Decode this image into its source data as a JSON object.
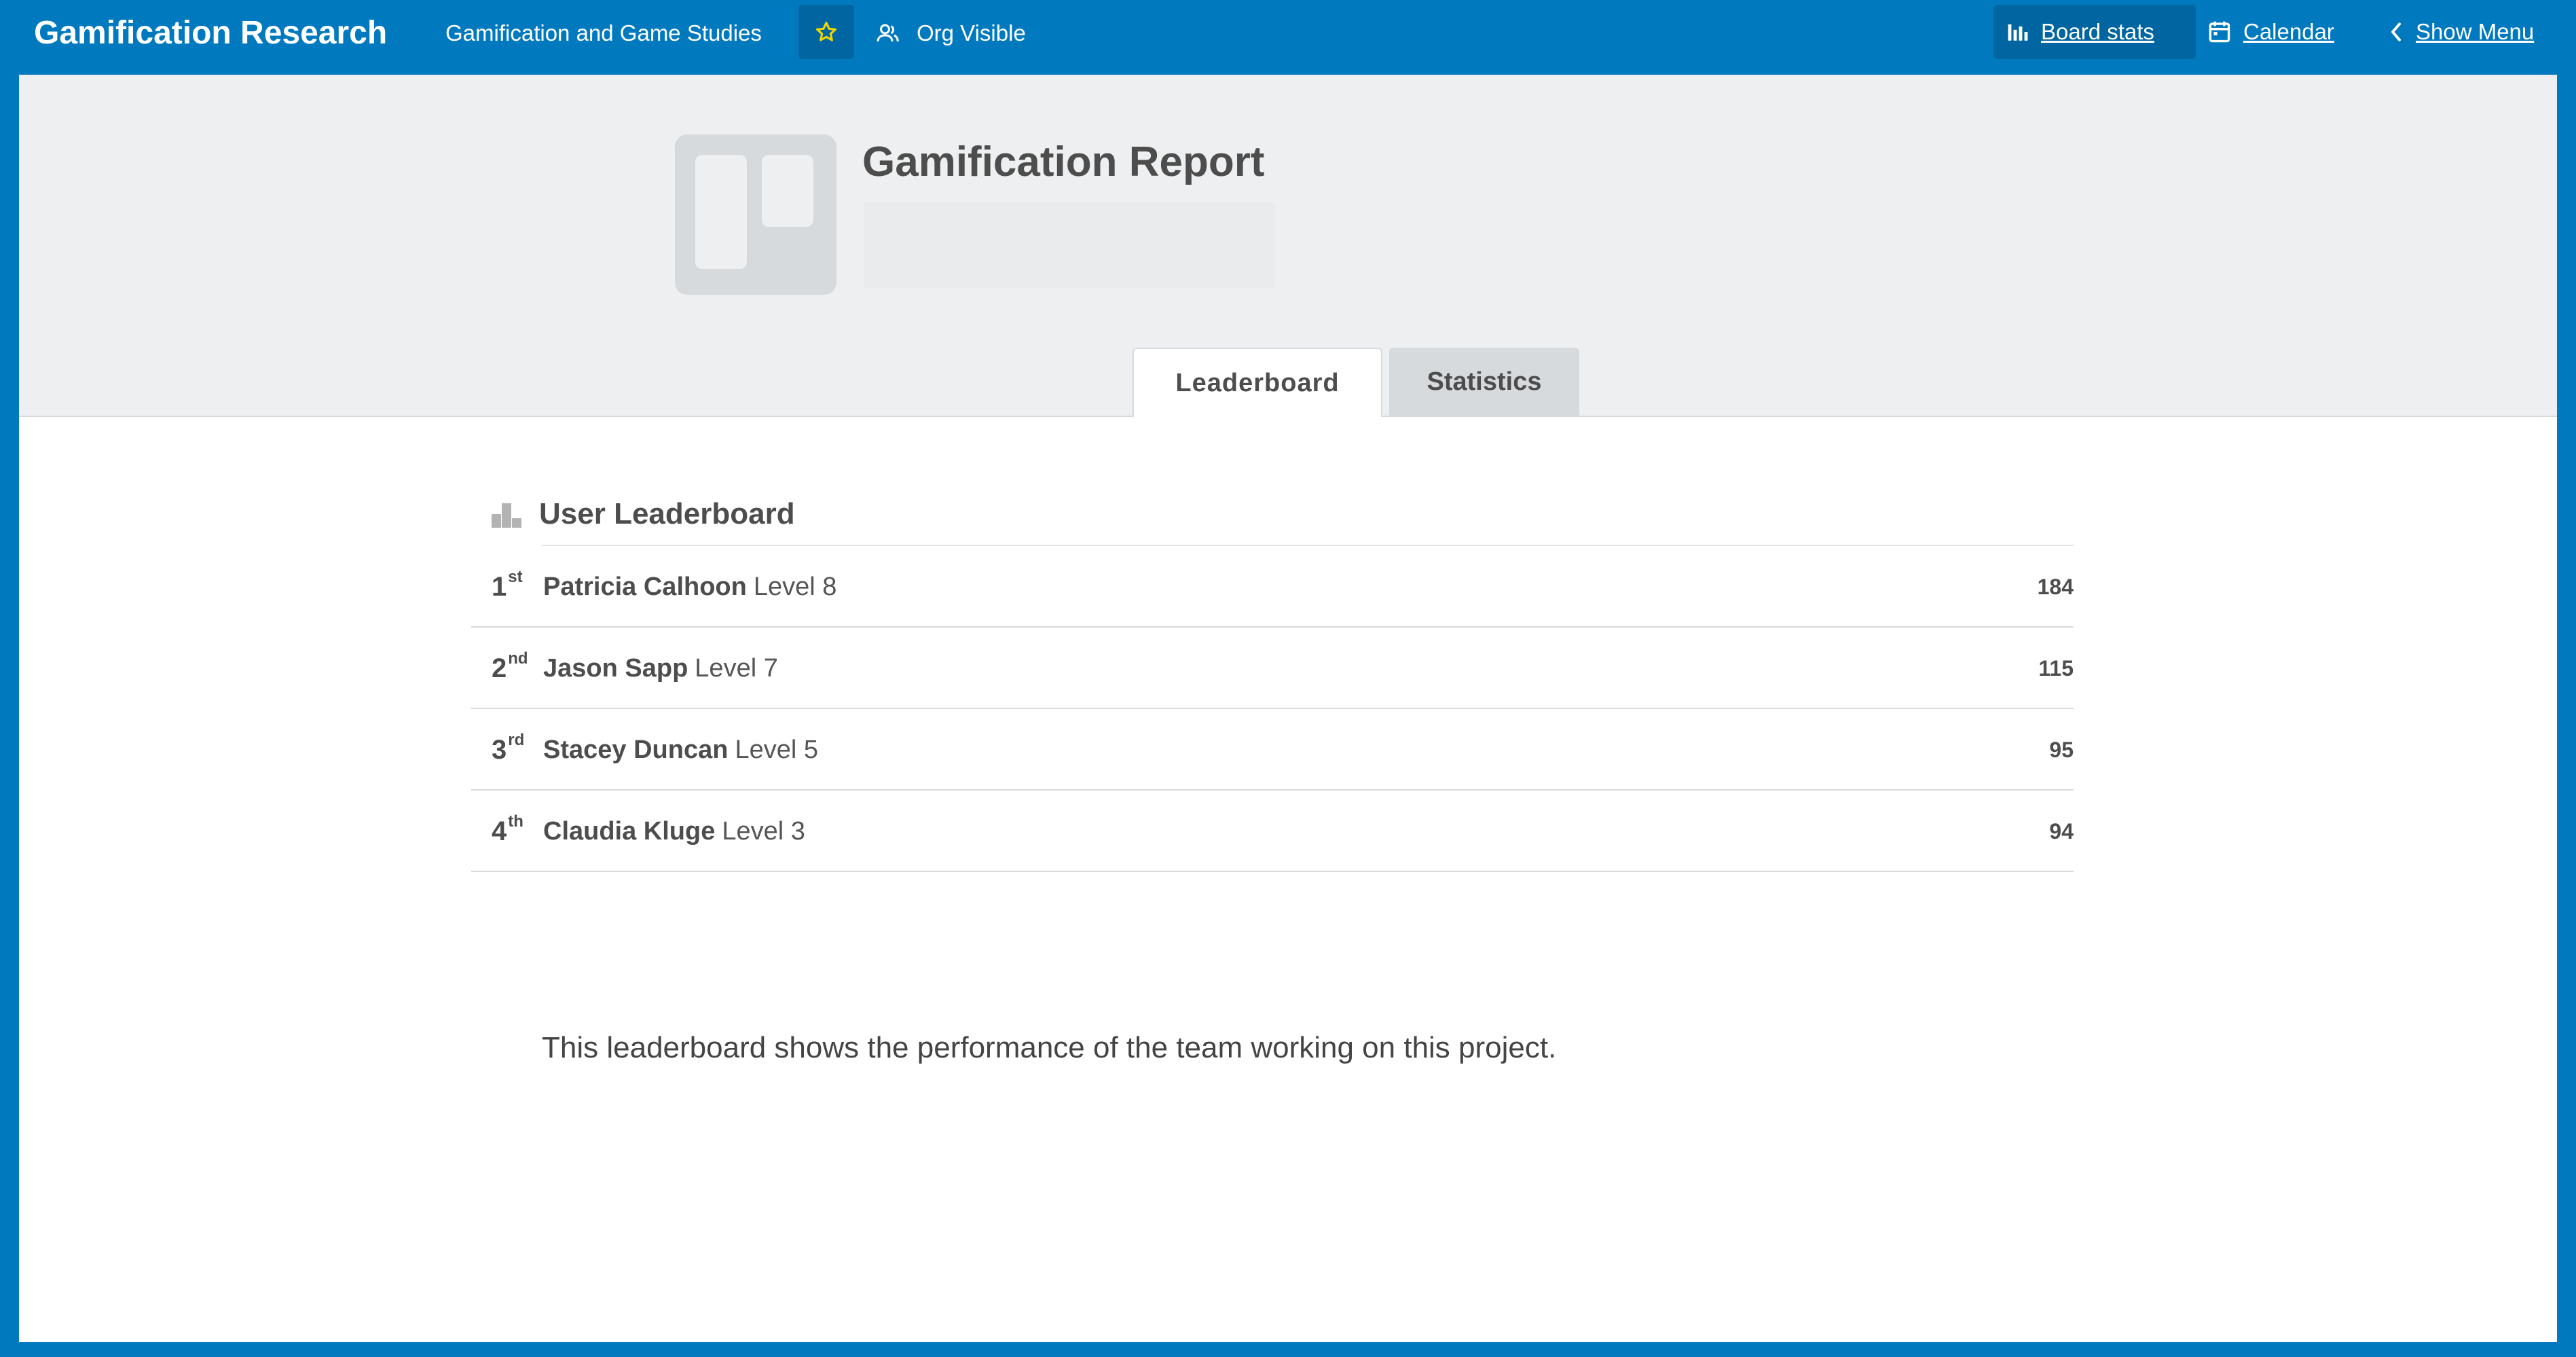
{
  "topbar": {
    "board_title": "Gamification Research",
    "team_name": "Gamification and Game Studies",
    "visibility_label": "Org Visible",
    "board_stats_label": "Board stats",
    "calendar_label": "Calendar",
    "show_menu_label": "Show Menu"
  },
  "report": {
    "title": "Gamification Report"
  },
  "tabs": [
    {
      "label": "Leaderboard",
      "active": true
    },
    {
      "label": "Statistics",
      "active": false
    }
  ],
  "leaderboard": {
    "title": "User Leaderboard",
    "rows": [
      {
        "rank": "1",
        "suffix": "st",
        "name": "Patricia Calhoon",
        "level": "Level 8",
        "score": "184"
      },
      {
        "rank": "2",
        "suffix": "nd",
        "name": "Jason Sapp",
        "level": "Level 7",
        "score": "115"
      },
      {
        "rank": "3",
        "suffix": "rd",
        "name": "Stacey Duncan",
        "level": "Level 5",
        "score": "95"
      },
      {
        "rank": "4",
        "suffix": "th",
        "name": "Claudia Kluge",
        "level": "Level 3",
        "score": "94"
      }
    ],
    "note": "This leaderboard shows the performance of the team working on this project."
  },
  "icons": {
    "star": "star-icon",
    "visibility": "org-visible-icon",
    "board_stats": "bar-chart-icon",
    "calendar": "calendar-icon",
    "show_menu": "chevron-left-icon",
    "leaderboard": "podium-icon"
  },
  "colors": {
    "topbar": "#0079bf",
    "star": "#f2d600",
    "header_bg": "#edeff0",
    "text": "#4d4d4d"
  }
}
